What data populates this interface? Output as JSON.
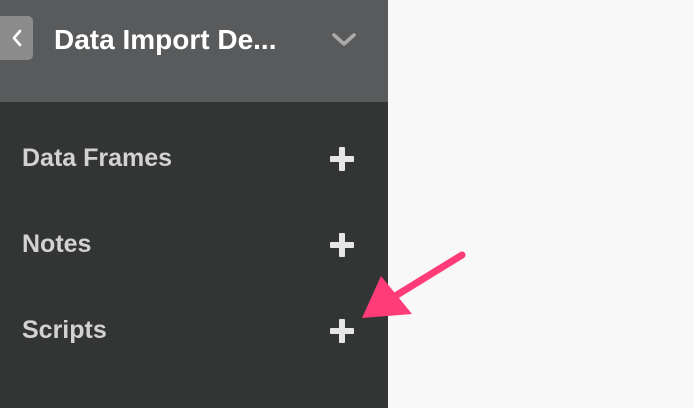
{
  "header": {
    "back_icon": "chevron-left-icon",
    "project_title": "Data Import De...",
    "dropdown_icon": "chevron-down-icon"
  },
  "sections": [
    {
      "label": "Data Frames",
      "add_icon": "plus-icon"
    },
    {
      "label": "Notes",
      "add_icon": "plus-icon"
    },
    {
      "label": "Scripts",
      "add_icon": "plus-icon"
    }
  ],
  "annotation": {
    "type": "arrow",
    "color": "#ff3c78",
    "points_to": "scripts-add-button"
  },
  "colors": {
    "sidebar_bg": "#333535",
    "header_bg": "#595a5b",
    "section_text": "#d2d2d2",
    "plus": "#e6e6e6",
    "main_bg": "#f8f8f8"
  }
}
